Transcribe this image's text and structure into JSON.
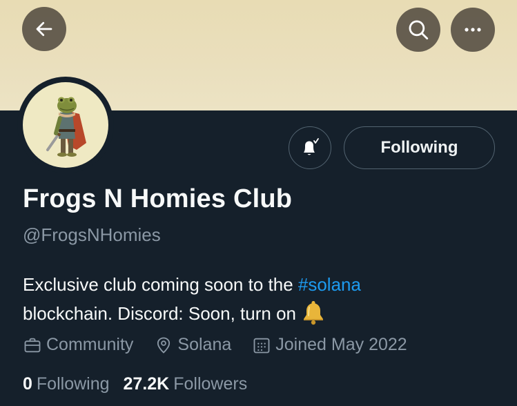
{
  "profile": {
    "name": "Frogs N Homies Club",
    "handle": "@FrogsNHomies",
    "bio_before": "Exclusive club coming soon to the ",
    "bio_hashtag": "#solana",
    "bio_after": " blockchain. Discord: Soon, turn on",
    "category": "Community",
    "location": "Solana",
    "joined": "Joined May 2022"
  },
  "actions": {
    "follow_label": "Following"
  },
  "stats": {
    "following_count": "0",
    "following_label": "Following",
    "followers_count": "27.2K",
    "followers_label": "Followers"
  },
  "icons": {
    "back": "arrow-left-icon",
    "search": "search-icon",
    "more": "more-icon",
    "notify": "bell-check-icon",
    "bio_emoji": "bell-emoji",
    "category": "briefcase-icon",
    "location": "location-pin-icon",
    "joined": "calendar-icon"
  },
  "colors": {
    "background": "#15202b",
    "banner": "#eadfbd",
    "hashtag": "#1d9bf0",
    "secondary_text": "#8b98a5",
    "border": "#536471"
  }
}
